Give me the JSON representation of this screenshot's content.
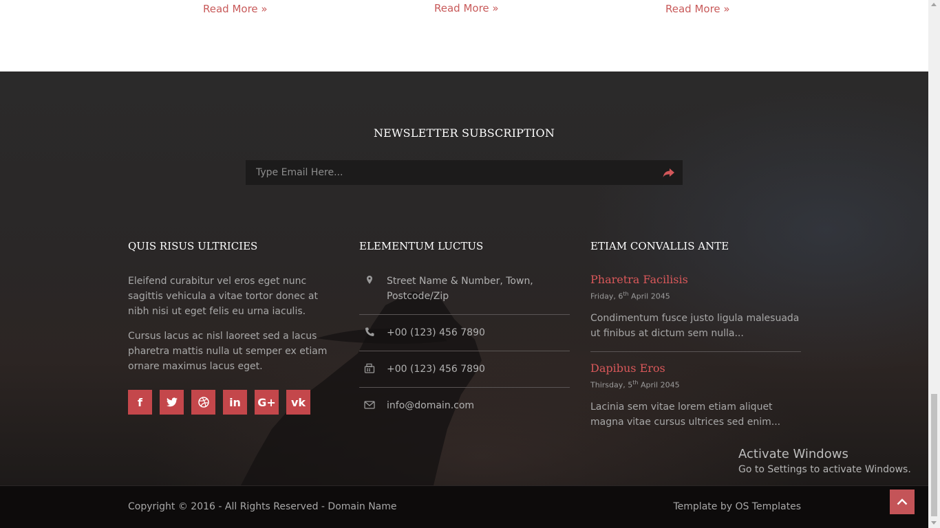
{
  "articles": {
    "read_more": [
      "Read More »",
      "Read More »",
      "Read More »"
    ]
  },
  "newsletter": {
    "title": "NEWSLETTER SUBSCRIPTION",
    "placeholder": "Type Email Here...",
    "submit_icon": "share-arrow-icon"
  },
  "col1": {
    "title": "QUIS RISUS ULTRICIES",
    "paragraphs": [
      "Eleifend curabitur vel eros eget nunc sagittis vehicula a vitae tortor donec at nibh nisi ut eget felis eu urna iaculis.",
      "Cursus lacus ac nisl laoreet sed a lacus pharetra mattis nulla ut semper ex etiam ornare maximus lacus eget."
    ],
    "social": [
      {
        "icon": "facebook-icon",
        "glyph": "f"
      },
      {
        "icon": "twitter-icon",
        "glyph": "t"
      },
      {
        "icon": "dribbble-icon",
        "glyph": "◎"
      },
      {
        "icon": "linkedin-icon",
        "glyph": "in"
      },
      {
        "icon": "google-plus-icon",
        "glyph": "G+"
      },
      {
        "icon": "vk-icon",
        "glyph": "vk"
      }
    ]
  },
  "col2": {
    "title": "ELEMENTUM LUCTUS",
    "address": "Street Name & Number, Town, Postcode/Zip",
    "phone": "+00 (123) 456 7890",
    "fax": "+00 (123) 456 7890",
    "email": "info@domain.com"
  },
  "col3": {
    "title": "ETIAM CONVALLIS ANTE",
    "posts": [
      {
        "title": "Pharetra Facilisis",
        "date_pre": "Friday, 6",
        "date_sup": "th",
        "date_post": " April 2045",
        "excerpt": "Condimentum fusce justo ligula malesuada ut finibus at dictum sem nulla..."
      },
      {
        "title": "Dapibus Eros",
        "date_pre": "Thirsday, 5",
        "date_sup": "th",
        "date_post": " April 2045",
        "excerpt": "Lacinia sem vitae lorem etiam aliquet magna vitae cursus ultrices sed enim..."
      }
    ]
  },
  "watermark": {
    "line1": "Activate Windows",
    "line2": "Go to Settings to activate Windows."
  },
  "bottom": {
    "copyright": "Copyright © 2016 - All Rights Reserved - Domain Name",
    "credit": "Template by OS Templates"
  },
  "colors": {
    "accent": "#c4474b",
    "link": "#c85a5a",
    "footer_bg": "#2b2a2a",
    "bottom_bg": "#0d0b0b"
  }
}
